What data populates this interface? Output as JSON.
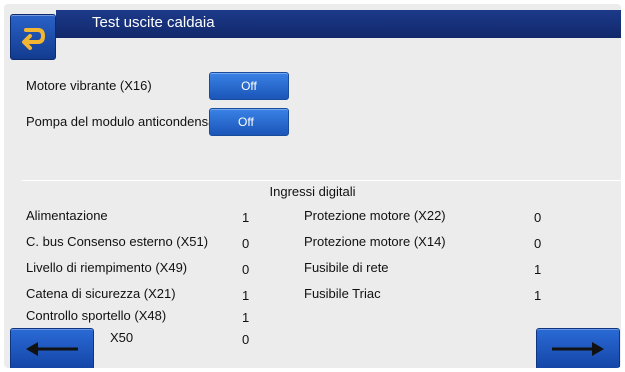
{
  "header": {
    "title": "Test uscite caldaia"
  },
  "outputs": [
    {
      "label": "Motore vibrante (X16)",
      "value": "Off"
    },
    {
      "label": "Pompa del modulo anticondensa",
      "value": "Off"
    }
  ],
  "digital_inputs": {
    "title": "Ingressi digitali",
    "left": [
      {
        "label": "Alimentazione",
        "value": "1"
      },
      {
        "label": "C. bus Consenso esterno (X51)",
        "value": "0"
      },
      {
        "label": "Livello di riempimento (X49)",
        "value": "0"
      },
      {
        "label": "Catena di sicurezza (X21)",
        "value": "1"
      },
      {
        "label": "Controllo sportello (X48)",
        "value": "1"
      },
      {
        "label": "X50",
        "value": "0"
      }
    ],
    "right": [
      {
        "label": "Protezione motore (X22)",
        "value": "0"
      },
      {
        "label": "Protezione motore (X14)",
        "value": "0"
      },
      {
        "label": "Fusibile di rete",
        "value": "1"
      },
      {
        "label": "Fusibile Triac",
        "value": "1"
      }
    ]
  },
  "icons": {
    "back": "back-arrow-icon",
    "prev": "arrow-left-icon",
    "next": "arrow-right-icon"
  },
  "colors": {
    "header_bg": "#1c3a8a",
    "button_blue": "#2a6ad6",
    "background": "#ececec"
  }
}
